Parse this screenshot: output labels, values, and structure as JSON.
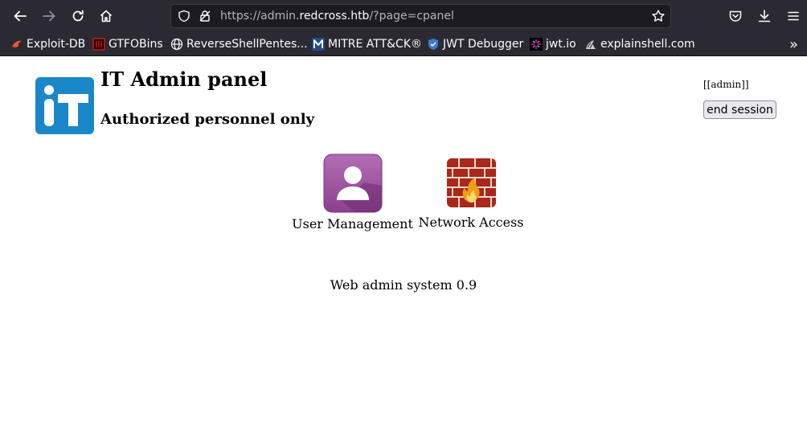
{
  "browser": {
    "url_prefix": "https://admin.",
    "url_domain": "redcross.htb",
    "url_suffix": "/?page=cpanel",
    "bookmarks": [
      {
        "label": "Exploit-DB",
        "icon": "exploit-db-icon"
      },
      {
        "label": "GTFOBins",
        "icon": "gtfobins-icon"
      },
      {
        "label": "ReverseShellPentes...",
        "icon": "globe-icon"
      },
      {
        "label": "MITRE ATT&CK®",
        "icon": "mitre-icon"
      },
      {
        "label": "JWT Debugger",
        "icon": "jwt-shield-icon"
      },
      {
        "label": "jwt.io",
        "icon": "jwt-io-icon"
      },
      {
        "label": "explainshell.com",
        "icon": "explainshell-icon"
      }
    ],
    "overflow_label": "»"
  },
  "header": {
    "logo_text": "iT",
    "title": "IT Admin panel",
    "subtitle": "Authorized personnel only",
    "user_label": "[[admin]]",
    "end_session_label": "end session"
  },
  "apps": [
    {
      "label": "User Management",
      "icon": "user-icon",
      "color": "#9b4f9d"
    },
    {
      "label": "Network Access",
      "icon": "firewall-icon",
      "color": "#c1392b"
    }
  ],
  "footer": {
    "text": "Web admin system 0.9"
  },
  "colors": {
    "chrome_bg": "#2b2a33",
    "urlbar_bg": "#1c1b22",
    "logo_blue": "#1a87c9"
  }
}
